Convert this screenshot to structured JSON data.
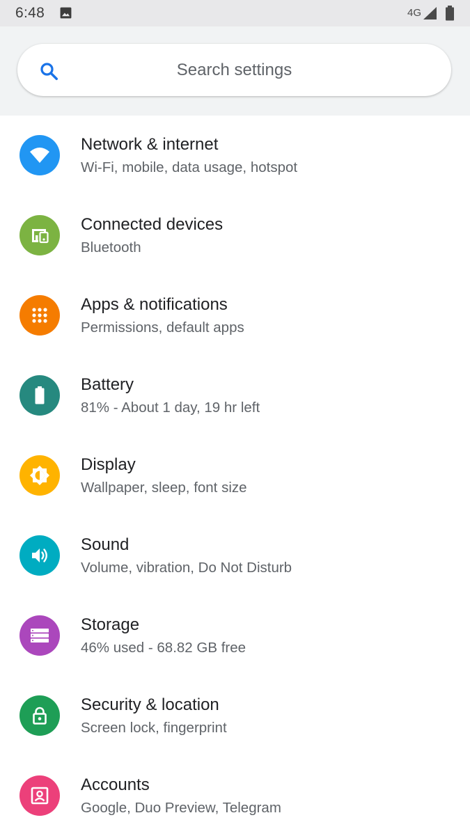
{
  "status_bar": {
    "time": "6:48",
    "network": "4G",
    "icons": [
      "image-notification-icon",
      "signal-icon",
      "battery-icon"
    ]
  },
  "search": {
    "placeholder": "Search settings",
    "icon": "search-icon",
    "accent": "#1a73e8"
  },
  "settings": [
    {
      "title": "Network & internet",
      "subtitle": "Wi-Fi, mobile, data usage, hotspot",
      "icon": "wifi-icon",
      "color": "#2196f3"
    },
    {
      "title": "Connected devices",
      "subtitle": "Bluetooth",
      "icon": "devices-icon",
      "color": "#7cb342"
    },
    {
      "title": "Apps & notifications",
      "subtitle": "Permissions, default apps",
      "icon": "apps-grid-icon",
      "color": "#f57c00"
    },
    {
      "title": "Battery",
      "subtitle": "81% - About 1 day, 19 hr left",
      "icon": "battery-icon",
      "color": "#26897f"
    },
    {
      "title": "Display",
      "subtitle": "Wallpaper, sleep, font size",
      "icon": "brightness-icon",
      "color": "#ffb300"
    },
    {
      "title": "Sound",
      "subtitle": "Volume, vibration, Do Not Disturb",
      "icon": "volume-icon",
      "color": "#00acc1"
    },
    {
      "title": "Storage",
      "subtitle": "46% used - 68.82 GB free",
      "icon": "storage-icon",
      "color": "#ab47bc"
    },
    {
      "title": "Security & location",
      "subtitle": "Screen lock, fingerprint",
      "icon": "lock-icon",
      "color": "#1e9e56"
    },
    {
      "title": "Accounts",
      "subtitle": "Google, Duo Preview, Telegram",
      "icon": "account-box-icon",
      "color": "#ec407a"
    }
  ]
}
